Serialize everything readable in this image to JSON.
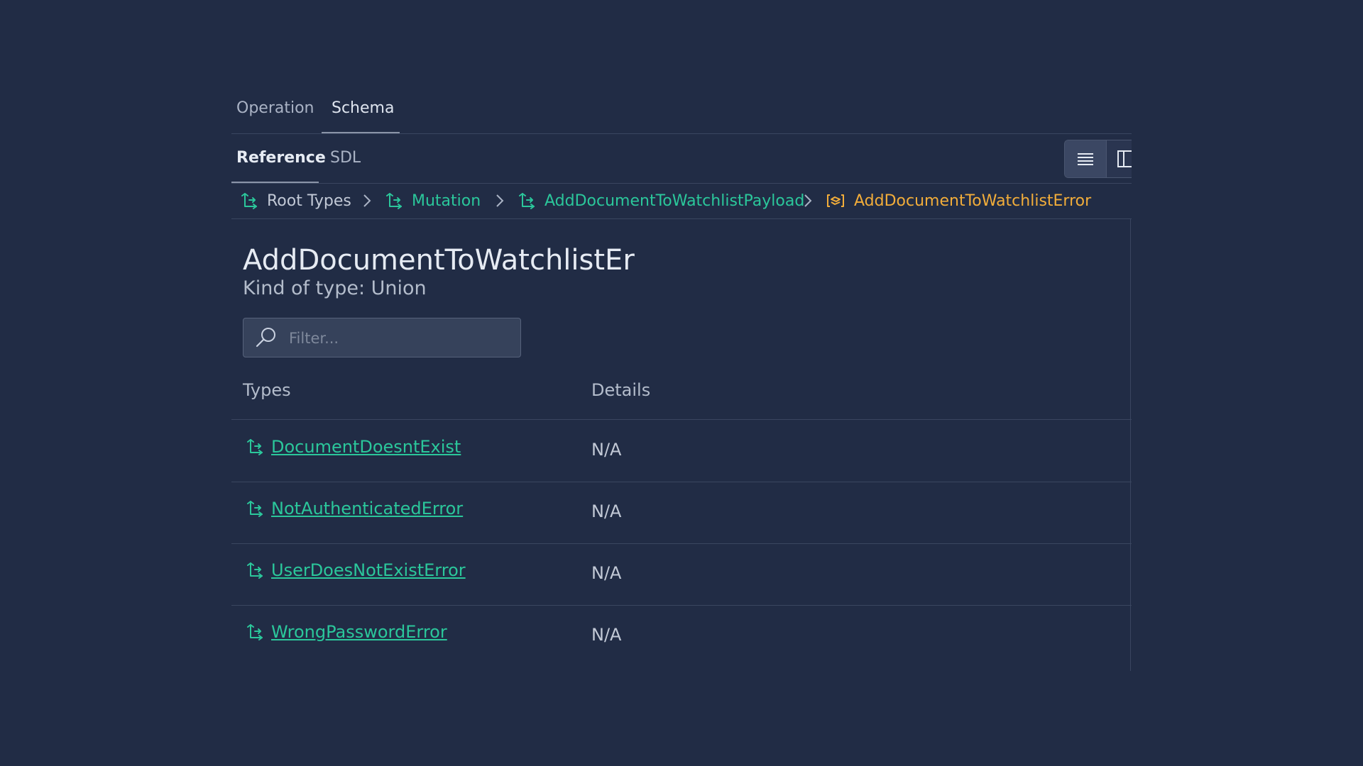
{
  "tabs": [
    {
      "label": "Operation",
      "active": false
    },
    {
      "label": "Schema",
      "active": true
    }
  ],
  "sub_tabs": [
    {
      "label": "Reference",
      "active": true
    },
    {
      "label": "SDL",
      "active": false
    }
  ],
  "view_toggle": {
    "icons": [
      "list-view-icon",
      "split-view-icon"
    ],
    "active": "list-view-icon"
  },
  "breadcrumb": [
    {
      "label": "Root Types",
      "icon": "object-type-icon",
      "color": "#c2c9d6"
    },
    {
      "label": "Mutation",
      "icon": "object-type-icon",
      "color": "#2bc79b"
    },
    {
      "label": "AddDocumentToWatchlistPayload",
      "icon": "object-type-icon",
      "color": "#2bc79b"
    },
    {
      "label": "AddDocumentToWatchlistError",
      "icon": "union-type-icon",
      "color": "#f2ad3a"
    }
  ],
  "type": {
    "name": "AddDocumentToWatchlistEr",
    "kind": "Kind of type: Union"
  },
  "filter": {
    "placeholder": "Filter...",
    "value": ""
  },
  "table": {
    "headers": [
      "Types",
      "Details"
    ],
    "rows": [
      {
        "type": "DocumentDoesntExist",
        "details": "N/A"
      },
      {
        "type": "NotAuthenticatedError",
        "details": "N/A"
      },
      {
        "type": "UserDoesNotExistError",
        "details": "N/A"
      },
      {
        "type": "WrongPasswordError",
        "details": "N/A"
      }
    ]
  },
  "colors": {
    "background": "#212c45",
    "link_green": "#2bc79b",
    "union_orange": "#f2ad3a"
  }
}
